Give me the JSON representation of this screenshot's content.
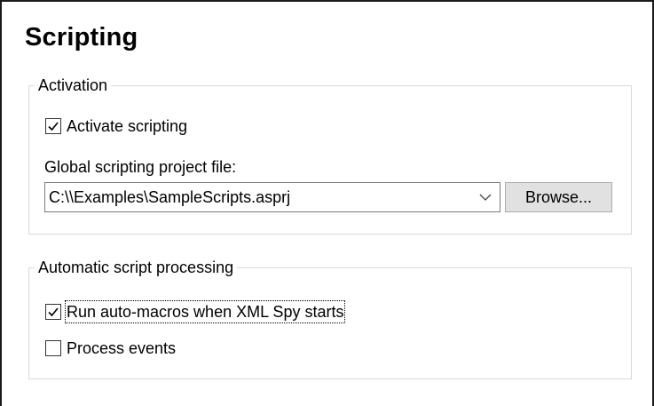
{
  "page": {
    "title": "Scripting"
  },
  "activation": {
    "legend": "Activation",
    "activate_checkbox": {
      "label": "Activate scripting",
      "checked": true
    },
    "project_file_label": "Global scripting project file:",
    "project_file_value": "C:\\\\Examples\\SampleScripts.asprj",
    "browse_label": "Browse..."
  },
  "automatic": {
    "legend": "Automatic script processing",
    "auto_macros_checkbox": {
      "label": "Run auto-macros when XML Spy starts",
      "checked": true
    },
    "process_events_checkbox": {
      "label": "Process events",
      "checked": false
    }
  },
  "icons": {
    "checkmark": "checkmark-icon",
    "dropdown": "chevron-down-icon"
  },
  "colors": {
    "groupbox_border": "#d9d9d9",
    "button_background": "#e1e1e1",
    "button_border": "#adadad",
    "combo_border": "#7a7a7a"
  }
}
